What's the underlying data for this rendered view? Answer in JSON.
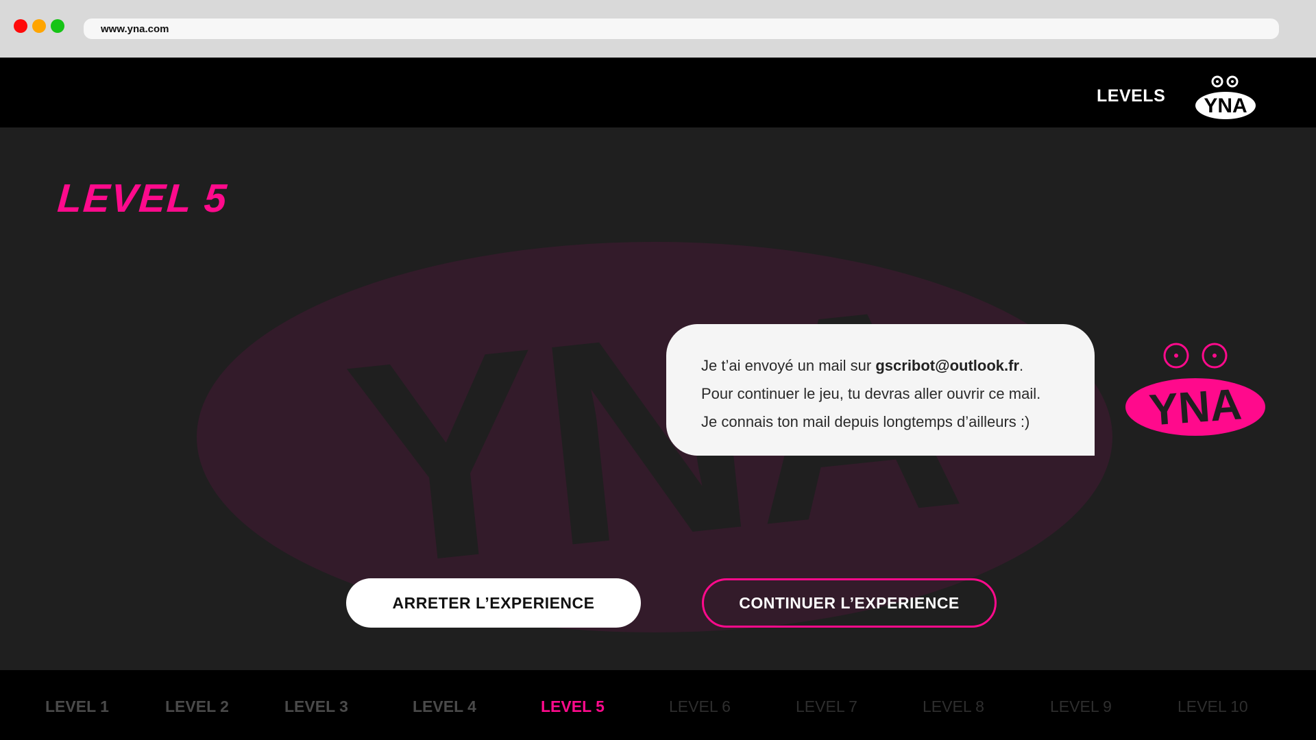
{
  "browser": {
    "url": "www.yna.com"
  },
  "topnav": {
    "levels_label": "LEVELS",
    "logo_text": "YNA"
  },
  "main": {
    "level_title": "LEVEL 5",
    "background_logo_text": "YNA",
    "message": {
      "line1_prefix": "Je t’ai envoyé un mail sur ",
      "email": "gscribot@outlook.fr",
      "line1_suffix": ".",
      "line2": "Pour continuer le jeu, tu devras aller ouvrir ce mail.",
      "line3": "Je connais ton mail depuis longtemps d’ailleurs :)"
    },
    "character_logo_text": "YNA",
    "stop_button": "ARRETER L’EXPERIENCE",
    "continue_button": "CONTINUER L’EXPERIENCE"
  },
  "levelbar": {
    "items": [
      {
        "label": "LEVEL 1",
        "state": "done"
      },
      {
        "label": "LEVEL 2",
        "state": "done"
      },
      {
        "label": "LEVEL 3",
        "state": "done"
      },
      {
        "label": "LEVEL 4",
        "state": "done"
      },
      {
        "label": "LEVEL 5",
        "state": "current"
      },
      {
        "label": "LEVEL 6",
        "state": "locked"
      },
      {
        "label": "LEVEL 7",
        "state": "locked"
      },
      {
        "label": "LEVEL 8",
        "state": "locked"
      },
      {
        "label": "LEVEL 9",
        "state": "locked"
      },
      {
        "label": "LEVEL 10",
        "state": "locked"
      }
    ]
  },
  "colors": {
    "accent": "#ff0a8c",
    "background": "#1f1f1f",
    "bars": "#000000",
    "bubble": "#f5f5f5"
  }
}
